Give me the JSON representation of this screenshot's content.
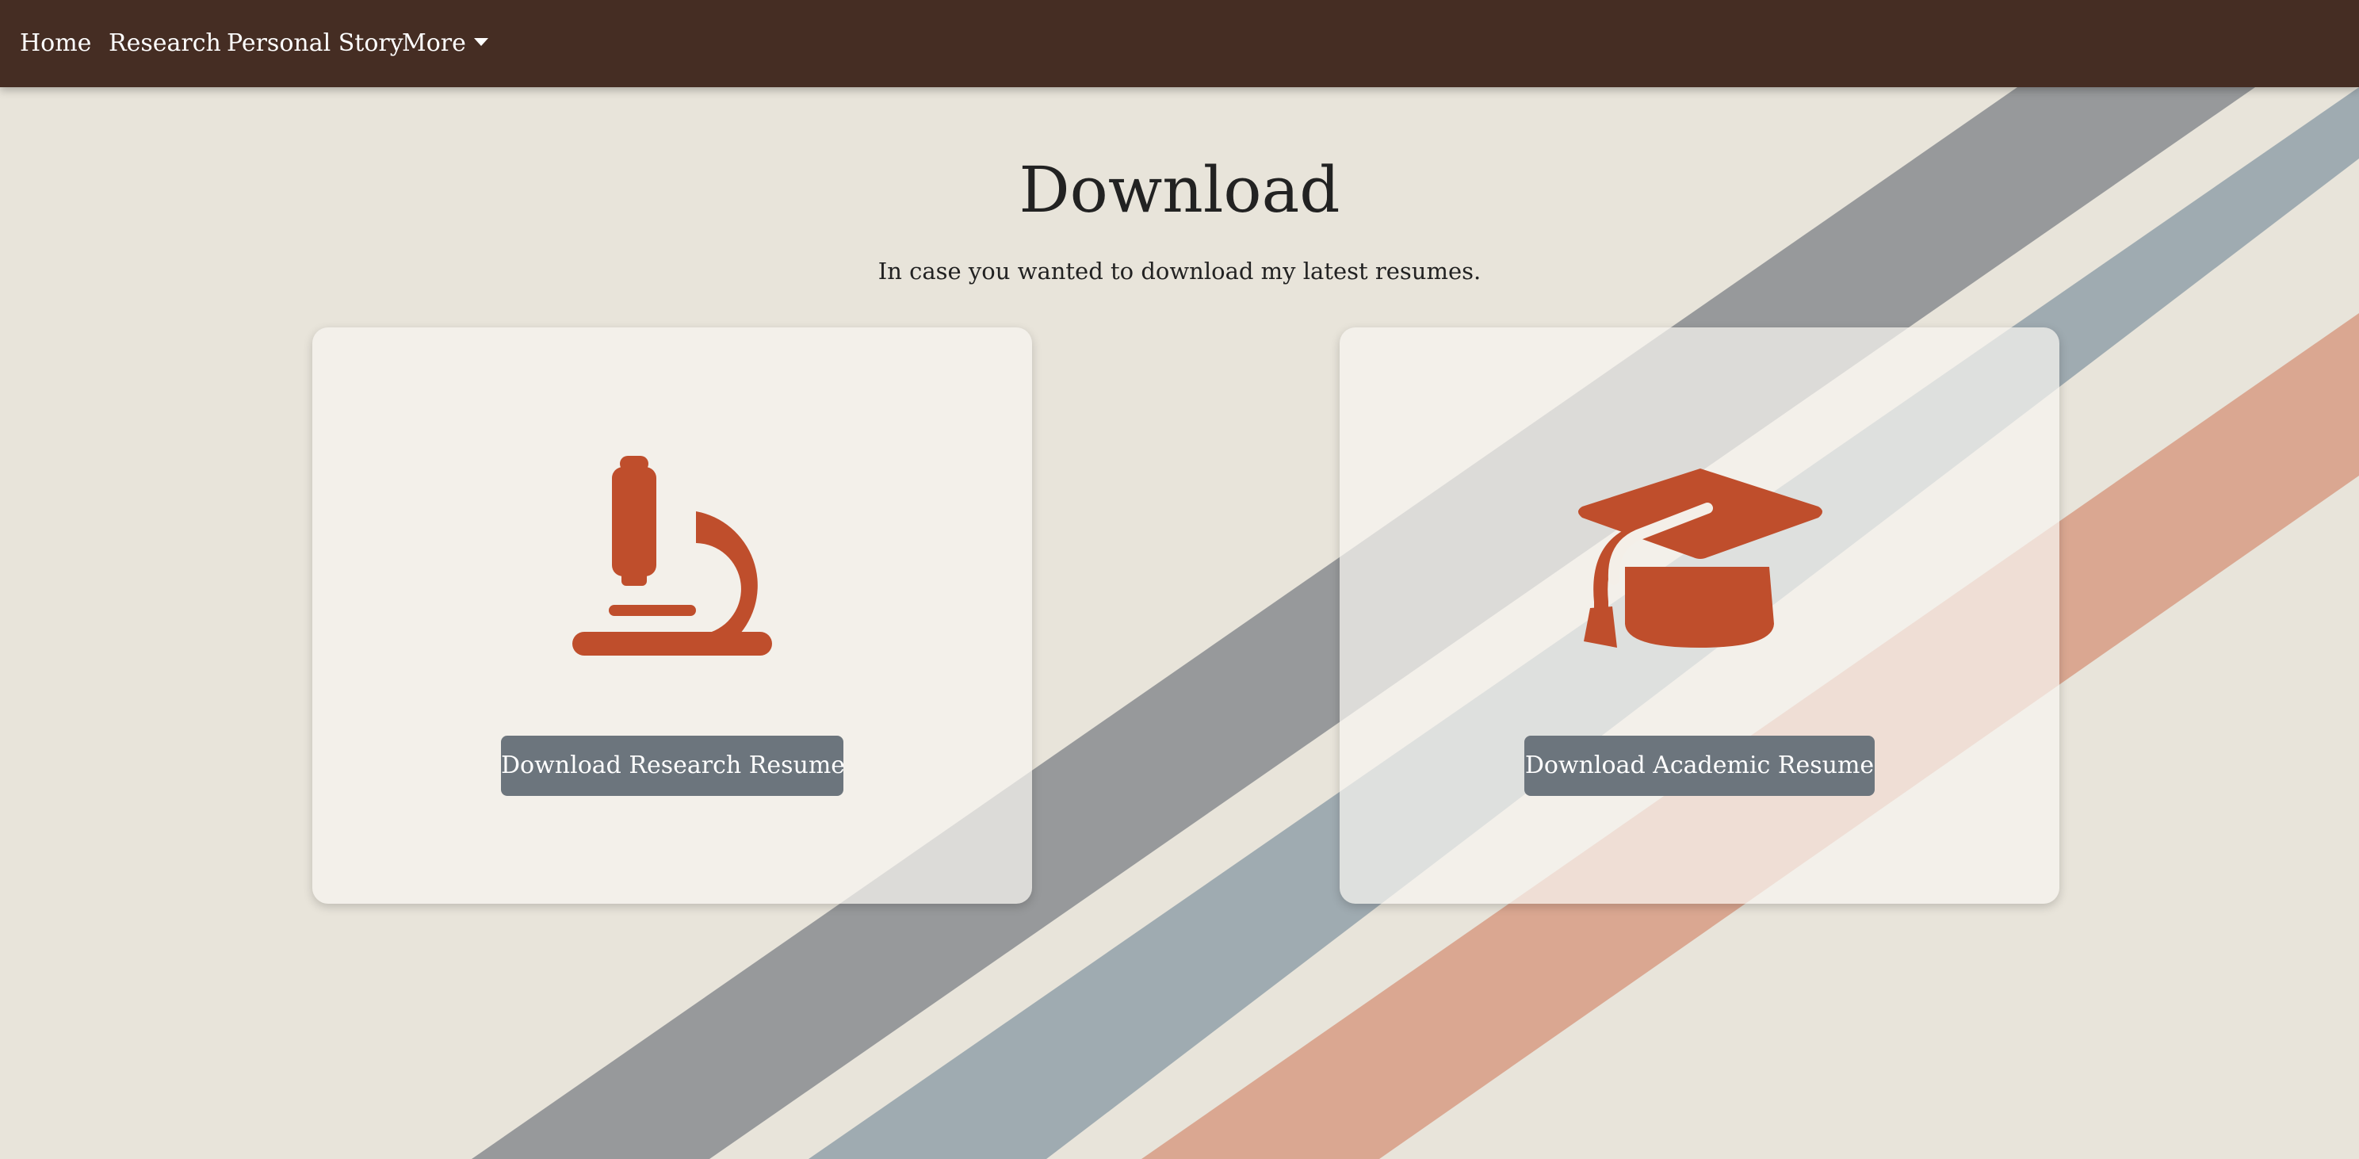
{
  "nav": {
    "items": [
      {
        "label": "Home"
      },
      {
        "label": "Research"
      },
      {
        "label": "Personal Story"
      },
      {
        "label": "More",
        "icon": "caret-down-icon"
      }
    ],
    "background": "#452d23"
  },
  "page": {
    "title": "Download",
    "subtitle": "In case you wanted to download my latest resumes.",
    "background": "#e8e4da"
  },
  "cards": [
    {
      "icon": "microscope-icon",
      "button_label": "Download Research Resume"
    },
    {
      "icon": "graduation-cap-icon",
      "button_label": "Download Academic Resume"
    }
  ],
  "colors": {
    "accent": "#bf4e2c",
    "button": "#6c757d",
    "stripe_dark": "#8f9296",
    "stripe_blue": "#98a6ae",
    "stripe_orange": "#d8a28b"
  }
}
